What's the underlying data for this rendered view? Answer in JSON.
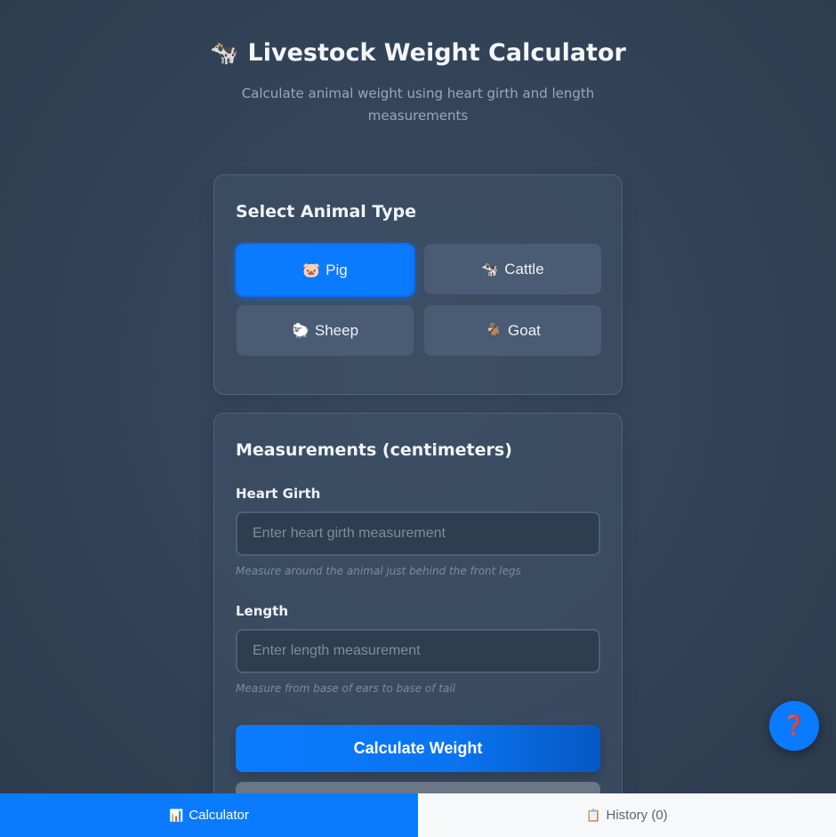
{
  "header": {
    "title_icon": "🐄",
    "title": "Livestock Weight Calculator",
    "subtitle": "Calculate animal weight using heart girth and length measurements"
  },
  "animal_select": {
    "heading": "Select Animal Type",
    "selected": "Pig",
    "options": [
      {
        "icon": "🐷",
        "label": "Pig"
      },
      {
        "icon": "🐄",
        "label": "Cattle"
      },
      {
        "icon": "🐑",
        "label": "Sheep"
      },
      {
        "icon": "🐐",
        "label": "Goat"
      }
    ]
  },
  "measurements": {
    "heading": "Measurements (centimeters)",
    "heart_girth": {
      "label": "Heart Girth",
      "value": "",
      "placeholder": "Enter heart girth measurement",
      "hint": "Measure around the animal just behind the front legs"
    },
    "length": {
      "label": "Length",
      "value": "",
      "placeholder": "Enter length measurement",
      "hint": "Measure from base of ears to base of tail"
    },
    "calculate_label": "Calculate Weight",
    "reset_label": ""
  },
  "help_button": {
    "icon": "❓"
  },
  "bottom_nav": {
    "tabs": [
      {
        "icon": "📊",
        "label": "Calculator",
        "active": true
      },
      {
        "icon": "📋",
        "label": "History (0)",
        "active": false
      }
    ]
  },
  "colors": {
    "accent": "#0a7bff",
    "background": "#34455a",
    "card": "#405268",
    "option_button": "#4a5b74"
  }
}
